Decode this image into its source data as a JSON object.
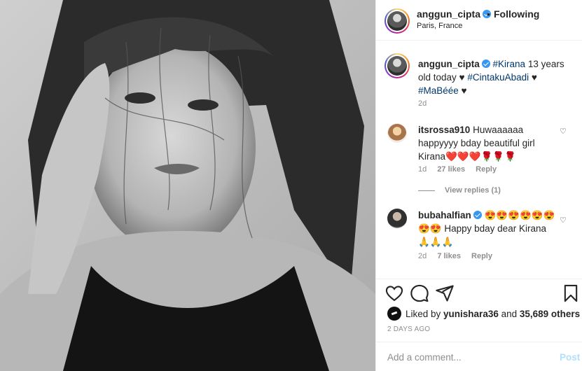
{
  "post": {
    "photo_alt": "post-photo",
    "author": {
      "username": "anggun_cipta",
      "follow_status": "Following",
      "location": "Paris, France"
    },
    "caption": {
      "username": "anggun_cipta",
      "hashtag1": "#Kirana",
      "text1": " 13 years old today ♥ ",
      "hashtag2": "#CintakuAbadi",
      "text2": " ♥ ",
      "hashtag3": "#MaBéée",
      "text3": " ♥",
      "time": "2d"
    },
    "comments": [
      {
        "username": "itsrossa910",
        "text": "Huwaaaaaa happyyyy bday beautiful girl Kirana",
        "emoji": "❤️❤️❤️🌹🌹🌹",
        "time": "1d",
        "likes": "27 likes",
        "reply": "Reply",
        "view_replies": "View replies (1)"
      },
      {
        "username": "bubahalfian",
        "emoji_lead": "😍😍😍😍😍😍😍😍",
        "text": " Happy bday dear Kirana ",
        "emoji_tail": "🙏🙏🙏",
        "time": "2d",
        "likes": "7 likes",
        "reply": "Reply"
      }
    ],
    "likes": {
      "prefix": "Liked by ",
      "user": "yunishara36",
      "middle": " and ",
      "count": "35,689 others"
    },
    "date": "2 DAYS AGO",
    "add_comment_placeholder": "Add a comment...",
    "post_label": "Post"
  }
}
